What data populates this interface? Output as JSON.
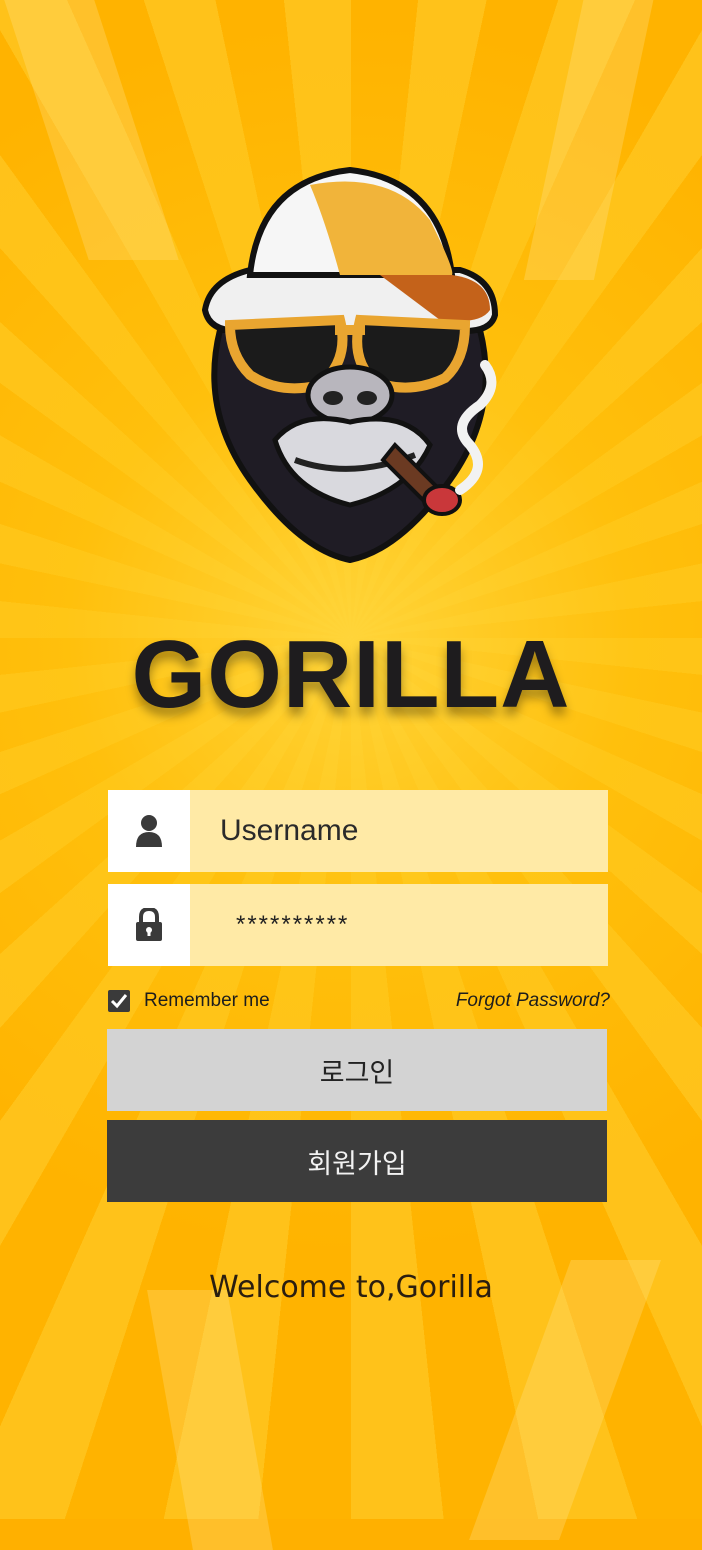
{
  "brand": {
    "name": "GORILLA"
  },
  "login_form": {
    "username_placeholder": "Username",
    "password_value": "**********",
    "remember_label": "Remember me",
    "remember_checked": true,
    "forgot_label": "Forgot Password?",
    "login_label": "로그인",
    "signup_label": "회원가입"
  },
  "footer": {
    "welcome_text": "Welcome to,Gorilla"
  },
  "colors": {
    "background": "#ffb000",
    "field_bg": "#ffeaa6",
    "login_button": "#d3d3d3",
    "signup_button": "#3c3c3c"
  },
  "icons": {
    "logo": "gorilla-mascot-logo",
    "username": "user-icon",
    "password": "lock-icon",
    "checkbox": "checkmark-icon"
  }
}
